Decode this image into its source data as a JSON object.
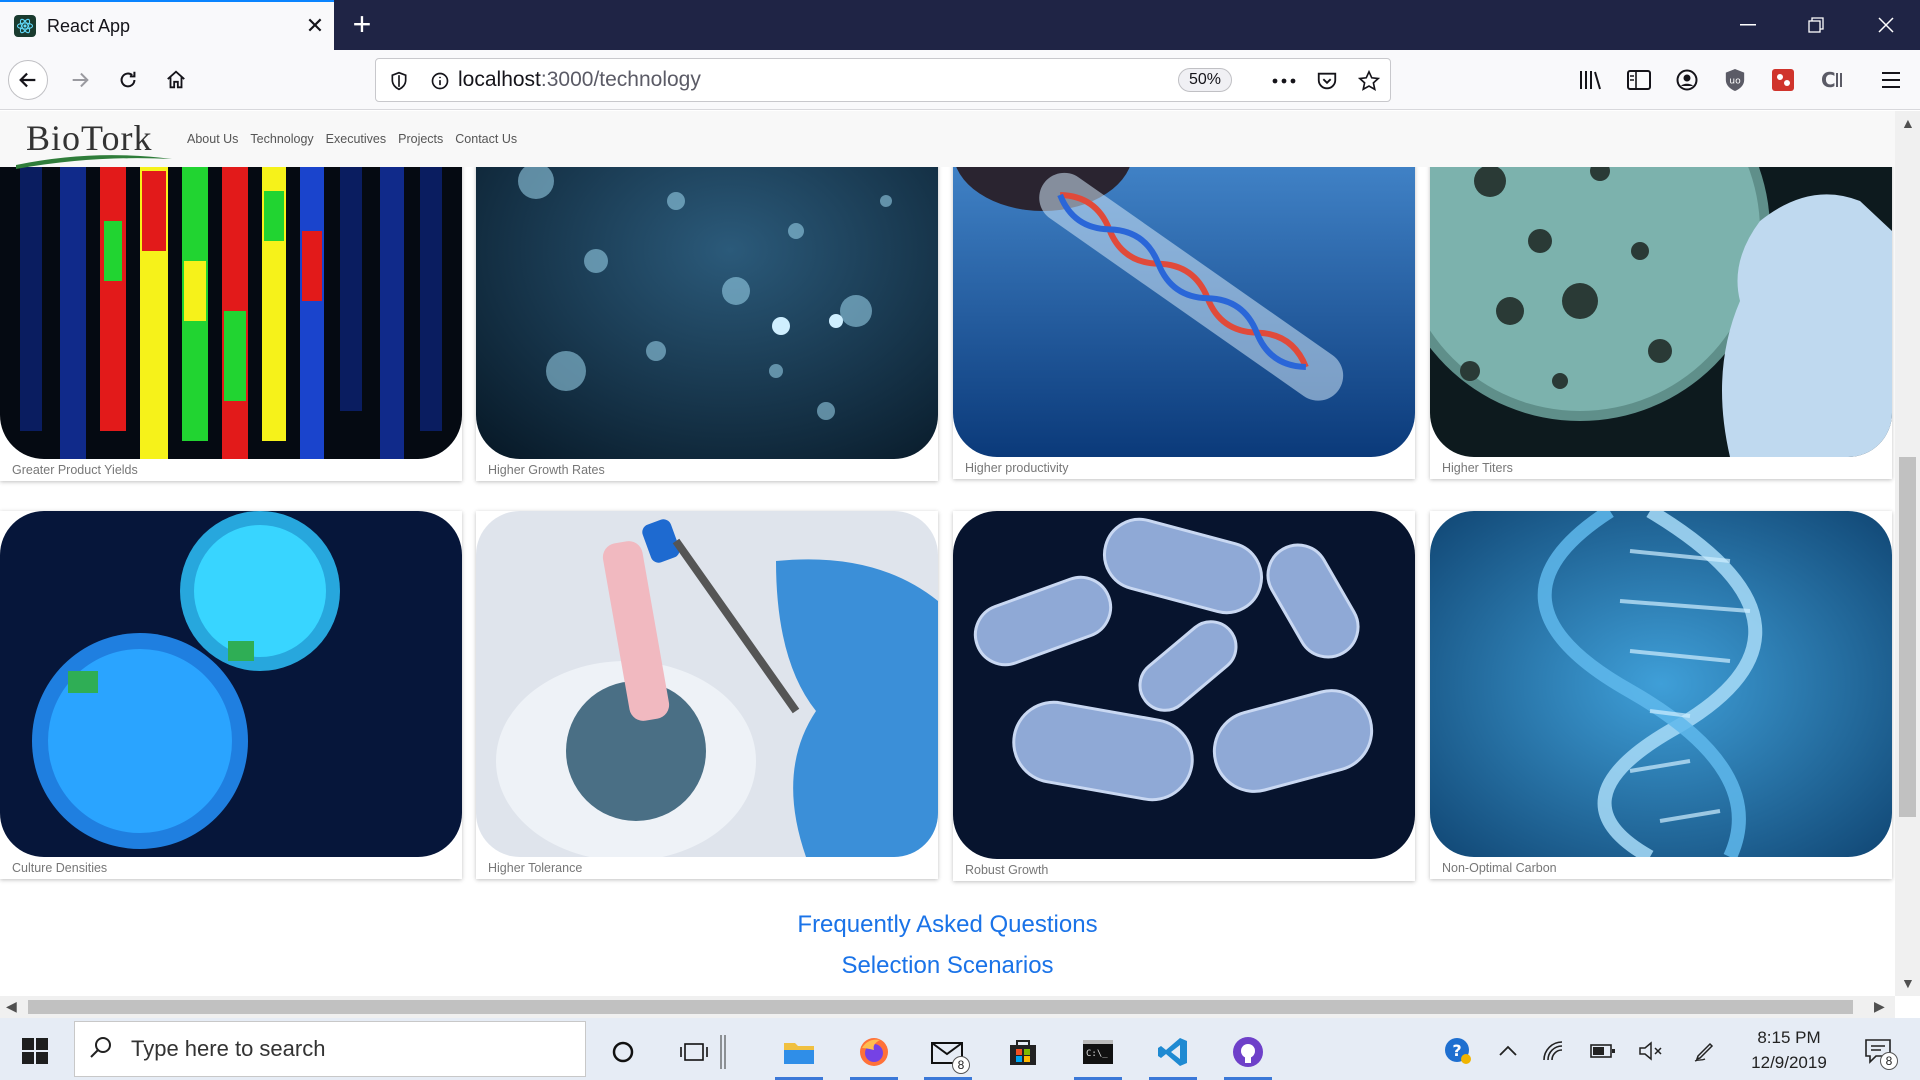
{
  "browser": {
    "tab_title": "React App",
    "url_host": "localhost",
    "url_path": ":3000/technology",
    "zoom": "50%"
  },
  "site": {
    "logo_text": "BioTork",
    "nav": [
      "About Us",
      "Technology",
      "Executives",
      "Projects",
      "Contact Us"
    ]
  },
  "cards": [
    {
      "caption": "Greater Product Yields"
    },
    {
      "caption": "Higher Growth Rates"
    },
    {
      "caption": "Higher productivity"
    },
    {
      "caption": "Higher Titers"
    },
    {
      "caption": "Culture Densities"
    },
    {
      "caption": "Higher Tolerance"
    },
    {
      "caption": "Robust Growth"
    },
    {
      "caption": "Non-Optimal Carbon"
    }
  ],
  "links": {
    "faq": "Frequently Asked Questions",
    "scenarios": "Selection Scenarios"
  },
  "taskbar": {
    "search_placeholder": "Type here to search",
    "mail_badge": "8",
    "notif_badge": "8",
    "time": "8:15 PM",
    "date": "12/9/2019"
  }
}
